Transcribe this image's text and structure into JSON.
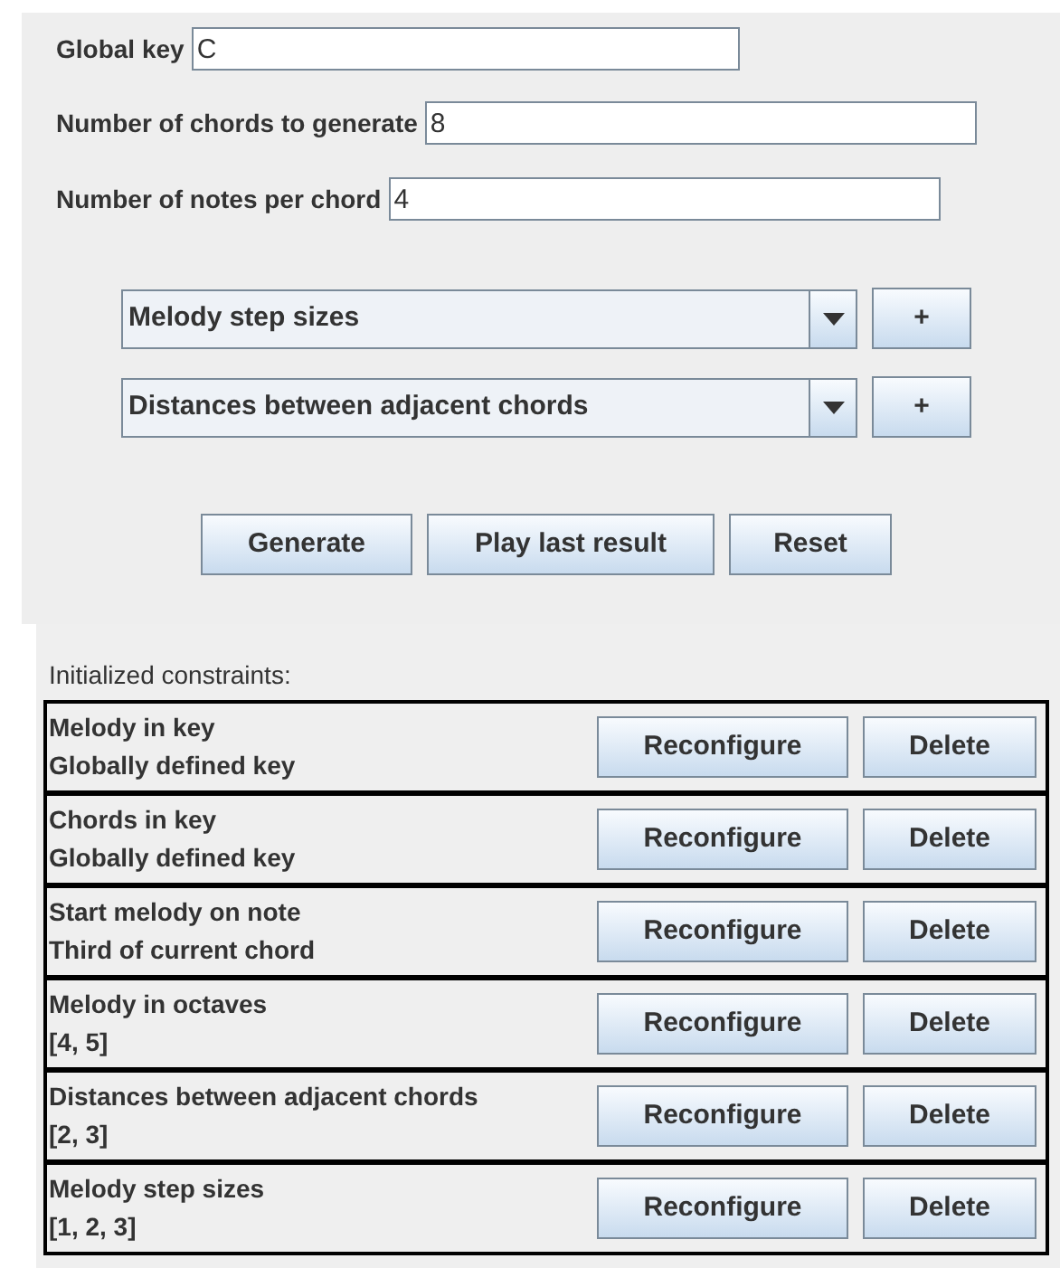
{
  "settings": [
    {
      "label": "Global key",
      "value": "C"
    },
    {
      "label": "Number of chords to generate",
      "value": "8"
    },
    {
      "label": "Number of notes per chord",
      "value": "4"
    }
  ],
  "constraint_pickers": [
    {
      "value": "Melody step sizes",
      "add_button": "+"
    },
    {
      "value": "Distances between adjacent chords",
      "add_button": "+"
    }
  ],
  "actions": [
    "Generate",
    "Play last result",
    "Reset"
  ],
  "constraints_heading": "Initialized constraints:",
  "constraints": [
    {
      "name": "Melody in key",
      "detail": "Globally defined key",
      "reconfigure": "Reconfigure",
      "delete": "Delete"
    },
    {
      "name": "Chords in key",
      "detail": "Globally defined key",
      "reconfigure": "Reconfigure",
      "delete": "Delete"
    },
    {
      "name": "Start melody on note",
      "detail": "Third of current chord",
      "reconfigure": "Reconfigure",
      "delete": "Delete"
    },
    {
      "name": "Melody in octaves",
      "detail": "[4, 5]",
      "reconfigure": "Reconfigure",
      "delete": "Delete"
    },
    {
      "name": "Distances between adjacent chords",
      "detail": "[2, 3]",
      "reconfigure": "Reconfigure",
      "delete": "Delete"
    },
    {
      "name": "Melody step sizes",
      "detail": "[1, 2, 3]",
      "reconfigure": "Reconfigure",
      "delete": "Delete"
    }
  ]
}
